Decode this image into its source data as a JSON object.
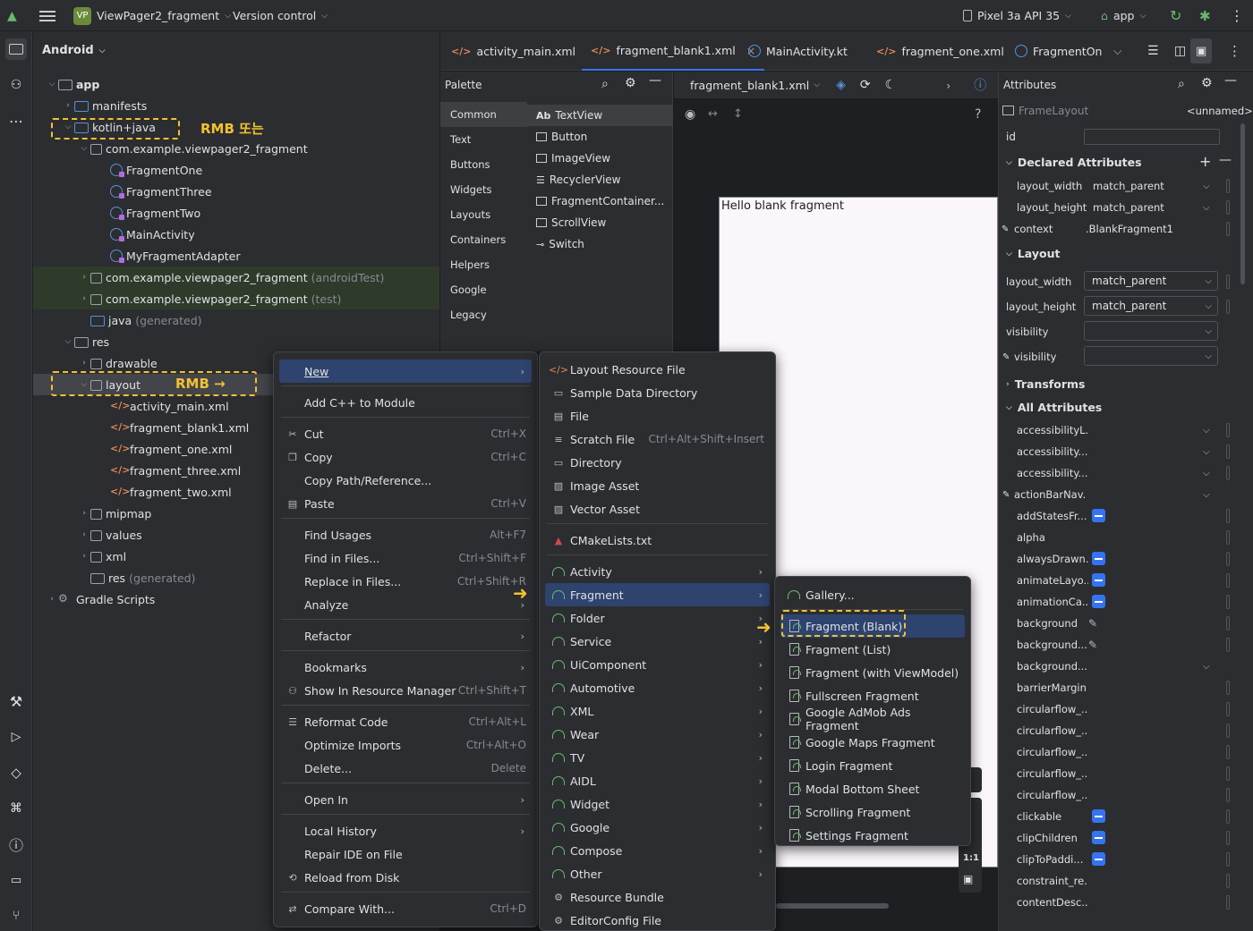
{
  "topbar": {
    "project_badge": "VP",
    "project_name": "ViewPager2_fragment",
    "vcs": "Version control",
    "device": "Pixel 3a API 35",
    "run_config": "app"
  },
  "project_panel": {
    "view_mode": "Android",
    "rows": [
      {
        "label": "app",
        "extra": ""
      },
      {
        "label": "manifests",
        "extra": ""
      },
      {
        "label": "kotlin+java",
        "extra": ""
      },
      {
        "label": "com.example.viewpager2_fragment",
        "extra": ""
      },
      {
        "label": "FragmentOne",
        "extra": ""
      },
      {
        "label": "FragmentThree",
        "extra": ""
      },
      {
        "label": "FragmentTwo",
        "extra": ""
      },
      {
        "label": "MainActivity",
        "extra": ""
      },
      {
        "label": "MyFragmentAdapter",
        "extra": ""
      },
      {
        "label": "com.example.viewpager2_fragment",
        "extra": "(androidTest)"
      },
      {
        "label": "com.example.viewpager2_fragment",
        "extra": "(test)"
      },
      {
        "label": "java",
        "extra": "(generated)"
      },
      {
        "label": "res",
        "extra": ""
      },
      {
        "label": "drawable",
        "extra": ""
      },
      {
        "label": "layout",
        "extra": ""
      },
      {
        "label": "activity_main.xml",
        "extra": ""
      },
      {
        "label": "fragment_blank1.xml",
        "extra": ""
      },
      {
        "label": "fragment_one.xml",
        "extra": ""
      },
      {
        "label": "fragment_three.xml",
        "extra": ""
      },
      {
        "label": "fragment_two.xml",
        "extra": ""
      },
      {
        "label": "mipmap",
        "extra": ""
      },
      {
        "label": "values",
        "extra": ""
      },
      {
        "label": "xml",
        "extra": ""
      },
      {
        "label": "res",
        "extra": "(generated)"
      },
      {
        "label": "Gradle Scripts",
        "extra": ""
      }
    ],
    "annotation_1": "RMB 또는",
    "annotation_2": "RMB →"
  },
  "editor_tabs": [
    {
      "label": "activity_main.xml"
    },
    {
      "label": "fragment_blank1.xml"
    },
    {
      "label": "MainActivity.kt"
    },
    {
      "label": "fragment_one.xml"
    },
    {
      "label": "FragmentOn"
    }
  ],
  "palette": {
    "title": "Palette",
    "categories": [
      "Common",
      "Text",
      "Buttons",
      "Widgets",
      "Layouts",
      "Containers",
      "Helpers",
      "Google",
      "Legacy"
    ],
    "items": [
      "TextView",
      "Button",
      "ImageView",
      "RecyclerView",
      "FragmentContainer...",
      "ScrollView",
      "Switch"
    ],
    "textview_prefix": "Ab"
  },
  "designer": {
    "file": "fragment_blank1.xml",
    "canvas_text": "Hello blank fragment",
    "help": "?",
    "ratio_label": "1:1"
  },
  "attributes": {
    "title": "Attributes",
    "component": "FrameLayout",
    "component_name": "<unnamed>",
    "id_label": "id",
    "declared_title": "Declared Attributes",
    "declared": [
      {
        "name": "layout_width",
        "value": "match_parent"
      },
      {
        "name": "layout_height",
        "value": "match_parent"
      },
      {
        "name": "context",
        "value": ".BlankFragment1"
      }
    ],
    "layout_title": "Layout",
    "layout": [
      {
        "name": "layout_width",
        "value": "match_parent"
      },
      {
        "name": "layout_height",
        "value": "match_parent"
      },
      {
        "name": "visibility",
        "value": ""
      },
      {
        "name": "visibility",
        "value": ""
      }
    ],
    "transforms_title": "Transforms",
    "all_title": "All Attributes",
    "all": [
      {
        "name": "accessibilityL...",
        "kind": "dd"
      },
      {
        "name": "accessibility...",
        "kind": "dd"
      },
      {
        "name": "accessibility...",
        "kind": "dd"
      },
      {
        "name": "actionBarNav...",
        "kind": "dd"
      },
      {
        "name": "addStatesFr...",
        "kind": "bool"
      },
      {
        "name": "alpha",
        "kind": "text"
      },
      {
        "name": "alwaysDrawn...",
        "kind": "bool"
      },
      {
        "name": "animateLayo...",
        "kind": "bool"
      },
      {
        "name": "animationCa...",
        "kind": "bool"
      },
      {
        "name": "background",
        "kind": "pick"
      },
      {
        "name": "background...",
        "kind": "pick"
      },
      {
        "name": "background...",
        "kind": "dd"
      },
      {
        "name": "barrierMargin",
        "kind": "text"
      },
      {
        "name": "circularflow_...",
        "kind": "text"
      },
      {
        "name": "circularflow_...",
        "kind": "text"
      },
      {
        "name": "circularflow_...",
        "kind": "text"
      },
      {
        "name": "circularflow_...",
        "kind": "text"
      },
      {
        "name": "circularflow_...",
        "kind": "text"
      },
      {
        "name": "clickable",
        "kind": "bool"
      },
      {
        "name": "clipChildren",
        "kind": "bool"
      },
      {
        "name": "clipToPaddi...",
        "kind": "bool"
      },
      {
        "name": "constraint_re...",
        "kind": "text"
      },
      {
        "name": "contentDesc...",
        "kind": "text"
      }
    ]
  },
  "context_menu": {
    "items": [
      {
        "label": "New",
        "shortcut": "",
        "sub": true
      },
      {
        "label": "Add C++ to Module",
        "shortcut": "",
        "sub": false
      },
      {
        "label": "Cut",
        "shortcut": "Ctrl+X",
        "sub": false
      },
      {
        "label": "Copy",
        "shortcut": "Ctrl+C",
        "sub": false
      },
      {
        "label": "Copy Path/Reference...",
        "shortcut": "",
        "sub": false
      },
      {
        "label": "Paste",
        "shortcut": "Ctrl+V",
        "sub": false
      },
      {
        "label": "Find Usages",
        "shortcut": "Alt+F7",
        "sub": false
      },
      {
        "label": "Find in Files...",
        "shortcut": "Ctrl+Shift+F",
        "sub": false
      },
      {
        "label": "Replace in Files...",
        "shortcut": "Ctrl+Shift+R",
        "sub": false
      },
      {
        "label": "Analyze",
        "shortcut": "",
        "sub": true
      },
      {
        "label": "Refactor",
        "shortcut": "",
        "sub": true
      },
      {
        "label": "Bookmarks",
        "shortcut": "",
        "sub": true
      },
      {
        "label": "Show In Resource Manager",
        "shortcut": "Ctrl+Shift+T",
        "sub": false
      },
      {
        "label": "Reformat Code",
        "shortcut": "Ctrl+Alt+L",
        "sub": false
      },
      {
        "label": "Optimize Imports",
        "shortcut": "Ctrl+Alt+O",
        "sub": false
      },
      {
        "label": "Delete...",
        "shortcut": "Delete",
        "sub": false
      },
      {
        "label": "Open In",
        "shortcut": "",
        "sub": true
      },
      {
        "label": "Local History",
        "shortcut": "",
        "sub": true
      },
      {
        "label": "Repair IDE on File",
        "shortcut": "",
        "sub": false
      },
      {
        "label": "Reload from Disk",
        "shortcut": "",
        "sub": false
      },
      {
        "label": "Compare With...",
        "shortcut": "Ctrl+D",
        "sub": false
      }
    ]
  },
  "new_menu": {
    "items": [
      {
        "label": "Layout Resource File",
        "shortcut": "",
        "sub": false
      },
      {
        "label": "Sample Data Directory",
        "shortcut": "",
        "sub": false
      },
      {
        "label": "File",
        "shortcut": "",
        "sub": false
      },
      {
        "label": "Scratch File",
        "shortcut": "Ctrl+Alt+Shift+Insert",
        "sub": false
      },
      {
        "label": "Directory",
        "shortcut": "",
        "sub": false
      },
      {
        "label": "Image Asset",
        "shortcut": "",
        "sub": false
      },
      {
        "label": "Vector Asset",
        "shortcut": "",
        "sub": false
      },
      {
        "label": "CMakeLists.txt",
        "shortcut": "",
        "sub": false
      },
      {
        "label": "Activity",
        "shortcut": "",
        "sub": true
      },
      {
        "label": "Fragment",
        "shortcut": "",
        "sub": true
      },
      {
        "label": "Folder",
        "shortcut": "",
        "sub": true
      },
      {
        "label": "Service",
        "shortcut": "",
        "sub": true
      },
      {
        "label": "UiComponent",
        "shortcut": "",
        "sub": true
      },
      {
        "label": "Automotive",
        "shortcut": "",
        "sub": true
      },
      {
        "label": "XML",
        "shortcut": "",
        "sub": true
      },
      {
        "label": "Wear",
        "shortcut": "",
        "sub": true
      },
      {
        "label": "TV",
        "shortcut": "",
        "sub": true
      },
      {
        "label": "AIDL",
        "shortcut": "",
        "sub": true
      },
      {
        "label": "Widget",
        "shortcut": "",
        "sub": true
      },
      {
        "label": "Google",
        "shortcut": "",
        "sub": true
      },
      {
        "label": "Compose",
        "shortcut": "",
        "sub": true
      },
      {
        "label": "Other",
        "shortcut": "",
        "sub": true
      },
      {
        "label": "Resource Bundle",
        "shortcut": "",
        "sub": false
      },
      {
        "label": "EditorConfig File",
        "shortcut": "",
        "sub": false
      }
    ]
  },
  "fragment_menu": {
    "items": [
      {
        "label": "Gallery..."
      },
      {
        "label": "Fragment (Blank)"
      },
      {
        "label": "Fragment (List)"
      },
      {
        "label": "Fragment (with ViewModel)"
      },
      {
        "label": "Fullscreen Fragment"
      },
      {
        "label": "Google AdMob Ads Fragment"
      },
      {
        "label": "Google Maps Fragment"
      },
      {
        "label": "Login Fragment"
      },
      {
        "label": "Modal Bottom Sheet"
      },
      {
        "label": "Scrolling Fragment"
      },
      {
        "label": "Settings Fragment"
      }
    ]
  }
}
